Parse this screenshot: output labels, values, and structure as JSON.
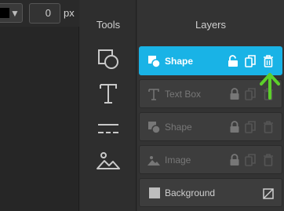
{
  "properties": {
    "color_value": "#000000",
    "size_value": "0",
    "size_unit": "px"
  },
  "tools": {
    "title": "Tools",
    "items": [
      {
        "name": "shape-tool"
      },
      {
        "name": "text-tool"
      },
      {
        "name": "line-tool"
      },
      {
        "name": "image-tool"
      }
    ]
  },
  "layers": {
    "title": "Layers",
    "items": [
      {
        "label": "Shape",
        "type": "shape",
        "active": true
      },
      {
        "label": "Text Box",
        "type": "text",
        "active": false
      },
      {
        "label": "Shape",
        "type": "shape",
        "active": false
      },
      {
        "label": "Image",
        "type": "image",
        "active": false
      },
      {
        "label": "Background",
        "type": "background",
        "active": false
      }
    ]
  },
  "colors": {
    "accent": "#19b3e6",
    "arrow": "#5ccf2a"
  }
}
